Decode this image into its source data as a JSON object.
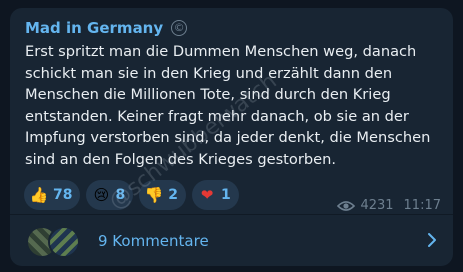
{
  "post": {
    "channel_name": "Mad in Germany",
    "text": "Erst spritzt man die Dummen Menschen weg, danach schickt man sie in den Krieg und erzählt dann den Menschen die Millionen Tote, sind durch den Krieg entstanden. Keiner fragt mehr danach, ob sie an der Impfung verstorben sind, da jeder denkt, die Menschen sind an den Folgen des Krieges gestorben.",
    "views": "4231",
    "time": "11:17",
    "watermark": "@schwubbelwatch"
  },
  "reactions": [
    {
      "icon": "thumbs-up-icon",
      "emoji": "👍",
      "count": "78"
    },
    {
      "icon": "sad-face-icon",
      "emoji": "😢",
      "count": "8"
    },
    {
      "icon": "thumbs-down-icon",
      "emoji": "👎",
      "count": "2"
    },
    {
      "icon": "heart-icon",
      "emoji": "❤",
      "count": "1"
    }
  ],
  "comments": {
    "label": "9 Kommentare"
  },
  "colors": {
    "background": "#0e1621",
    "bubble": "#182533",
    "accent": "#64b5ef",
    "text": "#e9eef2",
    "muted": "#6d7f8f"
  }
}
